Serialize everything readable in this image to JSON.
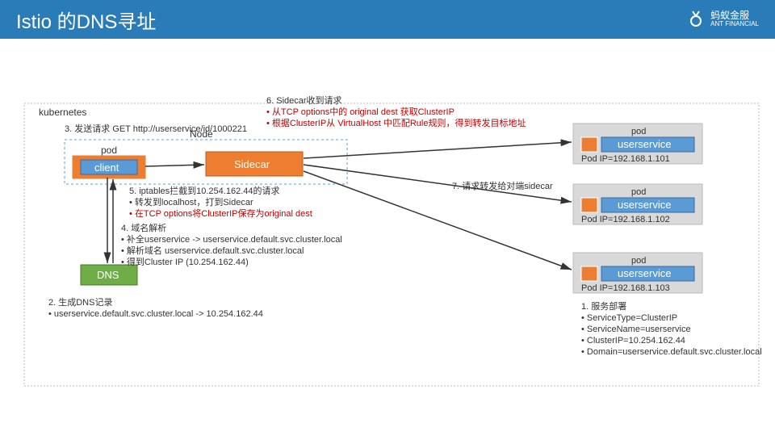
{
  "header": {
    "title": "Istio 的DNS寻址",
    "brand_cn": "蚂蚁金服",
    "brand_en": "ANT FINANCIAL"
  },
  "k8s_label": "kubernetes",
  "node": {
    "label": "Node",
    "pod": "pod",
    "client": "client",
    "sidecar": "Sidecar"
  },
  "dns": {
    "label": "DNS"
  },
  "step2": {
    "title": "2. 生成DNS记录",
    "b1": "userservice.default.svc.cluster.local -> 10.254.162.44"
  },
  "step3": {
    "title": "3. 发送请求 GET http://userservice/id/1000221"
  },
  "step4": {
    "title": "4. 域名解析",
    "b1": "补全userservice -> userservice.default.svc.cluster.local",
    "b2": "解析域名 userservice.default.svc.cluster.local",
    "b3": "得到Cluster IP (10.254.162.44)"
  },
  "step5": {
    "title": "5. iptables拦截到10.254.162.44的请求",
    "b1": "转发到localhost，打到Sidecar",
    "r1": "在TCP options将ClusterIP保存为original dest"
  },
  "step6": {
    "title": "6. Sidecar收到请求",
    "r1": "从TCP options中的 original dest 获取ClusterIP",
    "r2": "根据ClusterIP从 VirtualHost 中匹配Rule规则，得到转发目标地址"
  },
  "step7": {
    "title": "7. 请求转发给对端sidecar"
  },
  "step1": {
    "title": "1.    服务部署",
    "b1": "ServiceType=ClusterIP",
    "b2": "ServiceName=userservice",
    "b3": "ClusterIP=10.254.162.44",
    "b4": "Domain=userservice.default.svc.cluster.local"
  },
  "svc": {
    "pod": "pod",
    "name": "userservice",
    "ip1": "Pod IP=192.168.1.101",
    "ip2": "Pod IP=192.168.1.102",
    "ip3": "Pod IP=192.168.1.103"
  }
}
